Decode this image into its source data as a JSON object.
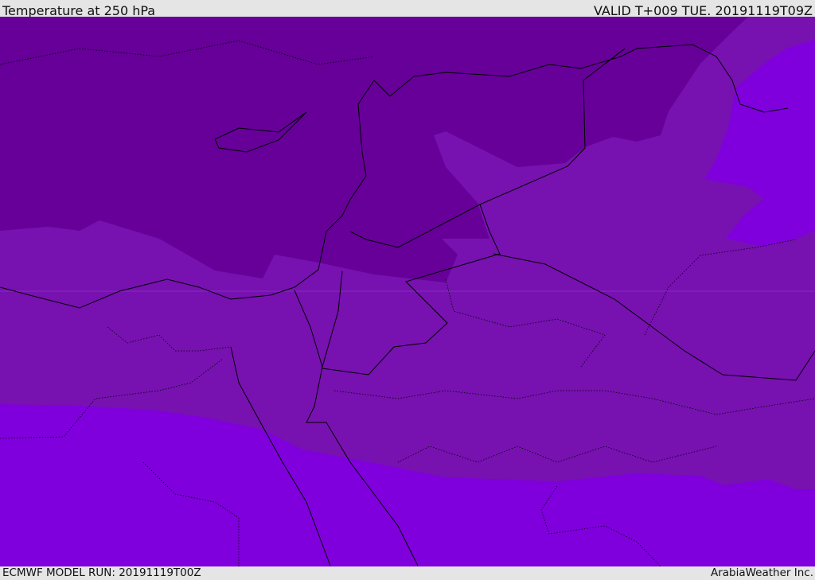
{
  "header": {
    "title": "Temperature at 250 hPa",
    "valid": "VALID T+009 TUE. 20191119T09Z"
  },
  "footer": {
    "model_run": "ECMWF MODEL RUN: 20191119T00Z",
    "credit": "ArabiaWeather Inc."
  },
  "colors": {
    "coldest": "#660099",
    "mid": "#7711b0",
    "warmest": "#7f00dd",
    "border": "#000000"
  }
}
